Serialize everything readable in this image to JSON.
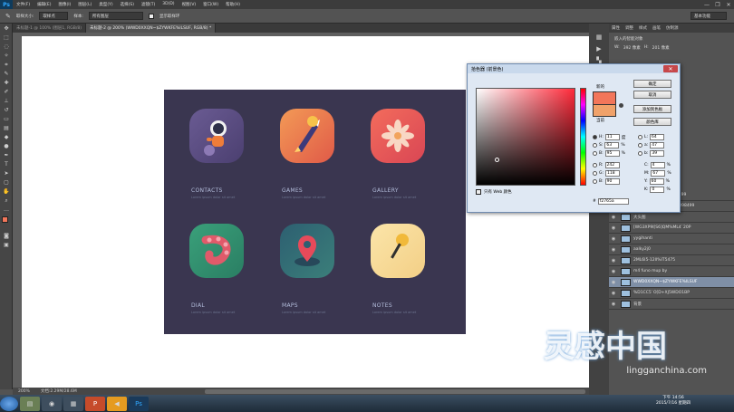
{
  "app": {
    "logo": "Ps",
    "title_menu": [
      "文件(F)",
      "编辑(E)",
      "图像(I)",
      "图层(L)",
      "类型(Y)",
      "选择(S)",
      "滤镜(T)",
      "3D(D)",
      "视图(V)",
      "窗口(W)",
      "帮助(H)"
    ]
  },
  "window_controls": [
    "—",
    "❐",
    "✕"
  ],
  "options": {
    "size_label": "取样大小:",
    "size_value": "取样点",
    "sample_label": "样本:",
    "sample_value": "所有图层",
    "ring_label": "显示取样环",
    "workspace": "基本功能"
  },
  "tabs": [
    {
      "label": "未标题-1 @ 100% (图层1, RGB/8)"
    },
    {
      "label": "未标题-2 @ 200% (WWD0XXQN~$ZYWKFE%ILSUF, RGB/8) *"
    }
  ],
  "status": {
    "zoom": "200%",
    "doc": "文档:2.29M/28.6M"
  },
  "artboard": {
    "apps": [
      {
        "label": "CONTACTS",
        "sub": "Lorem ipsum dolor sit amet"
      },
      {
        "label": "GAMES",
        "sub": "Lorem ipsum dolor sit amet"
      },
      {
        "label": "GALLERY",
        "sub": "Lorem ipsum dolor sit amet"
      },
      {
        "label": "DIAL",
        "sub": "Lorem ipsum dolor sit amet"
      },
      {
        "label": "MAPS",
        "sub": "Lorem ipsum dolor sit amet"
      },
      {
        "label": "NOTES",
        "sub": "Lorem ipsum dolor sit amet"
      }
    ]
  },
  "picker": {
    "title": "拾色器 (前景色)",
    "new_label": "新的",
    "current_label": "当前",
    "buttons": {
      "ok": "确定",
      "cancel": "取消",
      "add": "添加到色板",
      "library": "颜色库"
    },
    "hsb": [
      {
        "key": "H:",
        "value": "11",
        "unit": "度"
      },
      {
        "key": "S:",
        "value": "63",
        "unit": "%"
      },
      {
        "key": "B:",
        "value": "95",
        "unit": "%"
      }
    ],
    "rgb": [
      {
        "key": "R:",
        "value": "242"
      },
      {
        "key": "G:",
        "value": "118"
      },
      {
        "key": "B:",
        "value": "90"
      }
    ],
    "lab": [
      {
        "key": "L:",
        "value": "64"
      },
      {
        "key": "a:",
        "value": "47"
      },
      {
        "key": "b:",
        "value": "39"
      }
    ],
    "cmyk": [
      {
        "key": "C:",
        "value": "4",
        "unit": "%"
      },
      {
        "key": "M:",
        "value": "67",
        "unit": "%"
      },
      {
        "key": "Y:",
        "value": "60",
        "unit": "%"
      },
      {
        "key": "K:",
        "value": "0",
        "unit": "%"
      }
    ],
    "web_only": "只有 Web 颜色",
    "hex": "f2765a",
    "new_color": "#f2765a",
    "current_color": "#f0a26a"
  },
  "properties": {
    "tabs": [
      "属性",
      "调整",
      "样式",
      "画笔",
      "仿制源"
    ],
    "heading": "嵌入的智能对象",
    "w_label": "W:",
    "w_value": "392 像素",
    "h_label": "H:",
    "h_value": "201 像素"
  },
  "layers": [
    {
      "name": "WEXJNIAJYASQGWAD8499"
    },
    {
      "name": "DGBNISUSQ3JMQ6TS6898499"
    },
    {
      "name": "大头图"
    },
    {
      "name": "[WG3XP9I[S6]QM%ML4`20P"
    },
    {
      "name": "yygihanti"
    },
    {
      "name": "aalky2j0"
    },
    {
      "name": "2ML6I5-12II%IT5475"
    },
    {
      "name": "m4 funo mup by"
    },
    {
      "name": "WWD0XXQN~$ZYWKFE%ILSUF",
      "selected": true
    },
    {
      "name": "%D1CC5`O[D+XJ5WDO1BP"
    },
    {
      "name": "背景"
    }
  ],
  "clock": {
    "time": "下午 14:56",
    "date": "2015/7/16 星期四"
  },
  "watermark": {
    "cn": "灵感中国",
    "en": "lingganchina.com"
  }
}
